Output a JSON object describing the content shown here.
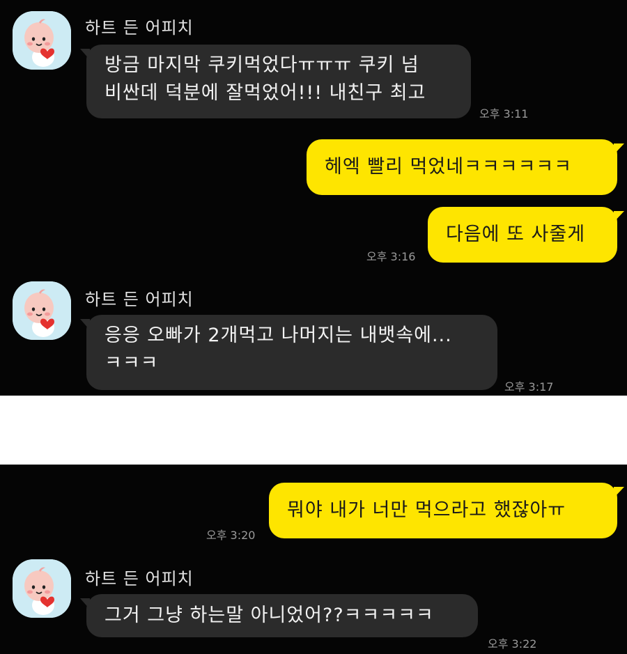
{
  "colors": {
    "background": "#050505",
    "incoming_bubble": "#2b2b2b",
    "outgoing_bubble": "#fee500",
    "timestamp": "#9a9a9a"
  },
  "sender": {
    "name": "하트 든 어피치",
    "avatar": "apeach-character-avatar"
  },
  "messages": [
    {
      "direction": "in",
      "lines": [
        "방금 마지막 쿠키먹었다ㅠㅠㅠ 쿠키 넘",
        "비싼데 덕분에 잘먹었어!!! 내친구 최고"
      ],
      "time": "오후 3:11"
    },
    {
      "direction": "out",
      "lines": [
        "헤엑 빨리 먹었네ㅋㅋㅋㅋㅋㅋ"
      ]
    },
    {
      "direction": "out",
      "lines": [
        "다음에 또 사줄게"
      ],
      "time": "오후 3:16"
    },
    {
      "direction": "in",
      "lines": [
        "응응 오빠가 2개먹고 나머지는 내뱃속에...",
        "ㅋㅋㅋ"
      ],
      "time": "오후 3:17"
    },
    {
      "direction": "out",
      "lines": [
        "뭐야 내가 너만 먹으라고 했잖아ㅠ"
      ],
      "time": "오후 3:20"
    },
    {
      "direction": "in",
      "lines": [
        "그거 그냥 하는말 아니었어??ㅋㅋㅋㅋㅋ"
      ],
      "time": "오후 3:22"
    }
  ]
}
